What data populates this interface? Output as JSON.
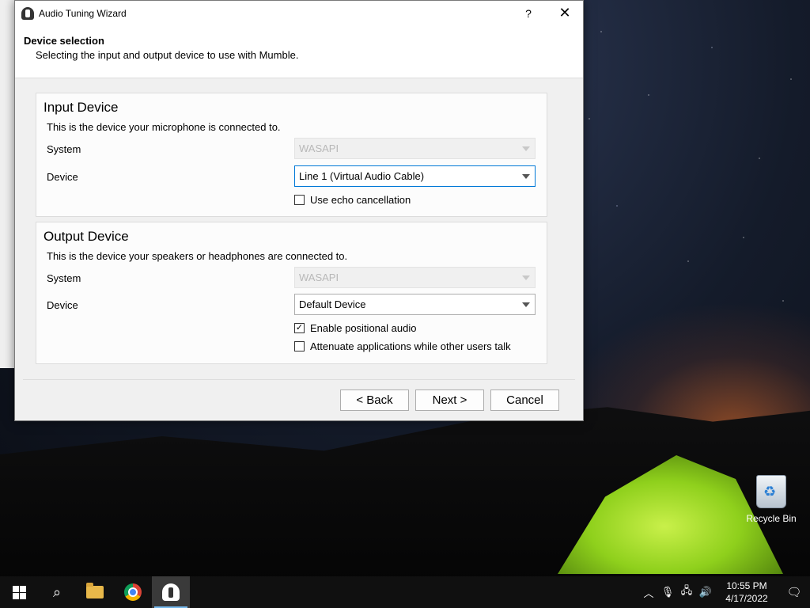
{
  "window": {
    "title": "Audio Tuning Wizard",
    "help_label": "?",
    "close_label": "✕"
  },
  "header": {
    "title": "Device selection",
    "subtitle": "Selecting the input and output device to use with Mumble."
  },
  "input_device": {
    "title": "Input Device",
    "description": "This is the device your microphone is connected to.",
    "system_label": "System",
    "system_value": "WASAPI",
    "device_label": "Device",
    "device_value": "Line 1 (Virtual Audio Cable)",
    "echo_label": "Use echo cancellation",
    "echo_checked": false
  },
  "output_device": {
    "title": "Output Device",
    "description": "This is the device your speakers or headphones are connected to.",
    "system_label": "System",
    "system_value": "WASAPI",
    "device_label": "Device",
    "device_value": "Default Device",
    "positional_label": "Enable positional audio",
    "positional_checked": true,
    "attenuate_label": "Attenuate applications while other users talk",
    "attenuate_checked": false
  },
  "buttons": {
    "back": "< Back",
    "next": "Next >",
    "cancel": "Cancel"
  },
  "desktop": {
    "recycle_bin_label": "Recycle Bin"
  },
  "taskbar": {
    "apps": [
      "windows-start",
      "search",
      "file-explorer",
      "chrome",
      "mumble"
    ],
    "time": "10:55 PM",
    "date": "4/17/2022"
  }
}
